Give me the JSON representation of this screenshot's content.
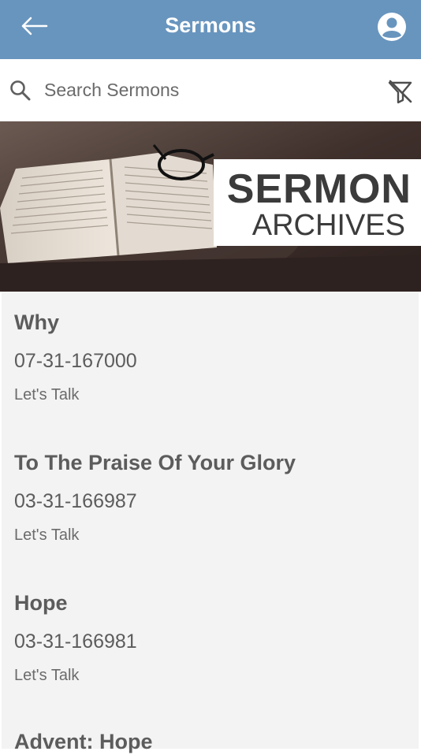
{
  "header": {
    "title": "Sermons",
    "back_icon": "arrow-left-icon",
    "account_icon": "account-circle-icon",
    "background": "#6895be"
  },
  "search": {
    "placeholder": "Search Sermons",
    "value": "",
    "search_icon": "search-icon",
    "filter_icon": "filter-off-icon"
  },
  "banner": {
    "line1": "SERMON",
    "line2": "ARCHIVES"
  },
  "sermons": [
    {
      "title": "Why",
      "date": "07-31-167000",
      "speaker": "Let's Talk"
    },
    {
      "title": "To The Praise Of Your Glory",
      "date": "03-31-166987",
      "speaker": "Let's Talk"
    },
    {
      "title": "Hope",
      "date": "03-31-166981",
      "speaker": "Let's Talk"
    },
    {
      "title": "Advent: Hope",
      "date": "",
      "speaker": ""
    }
  ]
}
